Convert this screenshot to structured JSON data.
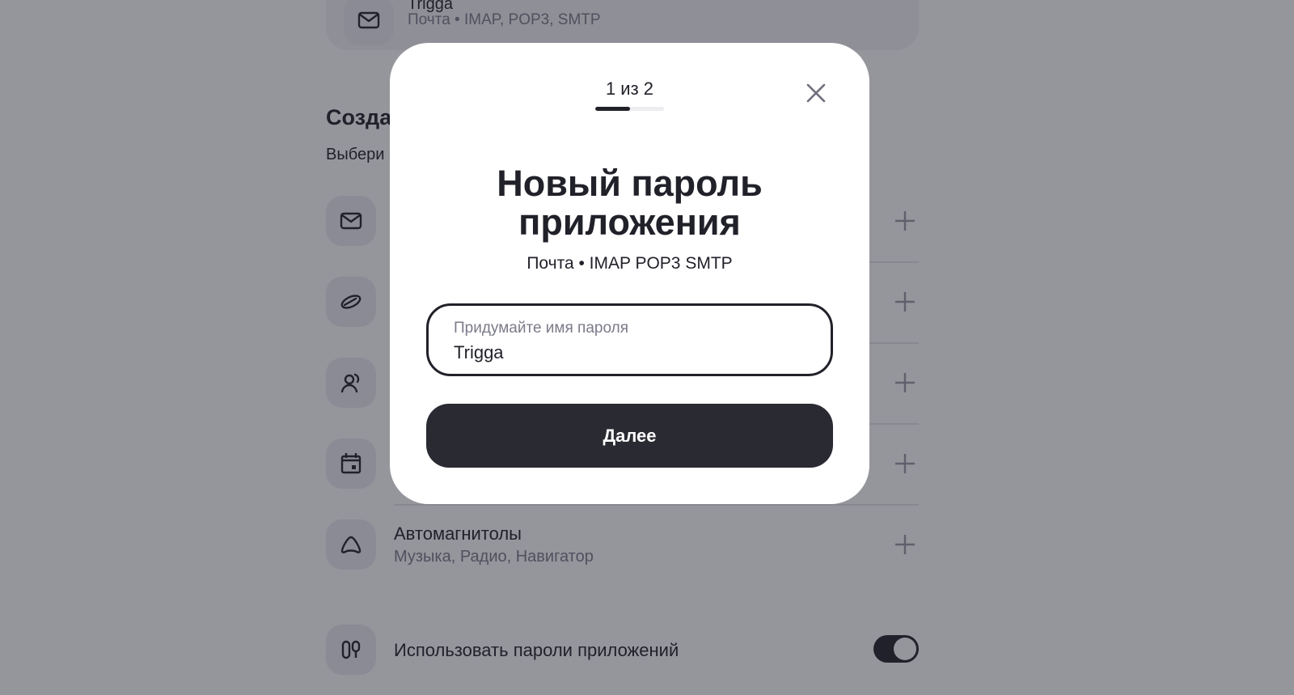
{
  "background": {
    "top_card": {
      "name": "Trigga",
      "subtitle": "Почта • IMAP, POP3, SMTP",
      "icon": "mail-icon"
    },
    "section": {
      "title": "Созда",
      "subtitle": "Выбери"
    },
    "rows": [
      {
        "icon": "mail-icon"
      },
      {
        "icon": "disk-icon"
      },
      {
        "icon": "contacts-icon"
      },
      {
        "icon": "calendar-icon"
      },
      {
        "icon": "car-icon",
        "title": "Автомагнитолы",
        "subtitle": "Музыка, Радио, Навигатор"
      }
    ],
    "app_passwords": {
      "icon": "keys-icon",
      "label": "Использовать пароли приложений",
      "enabled": true
    }
  },
  "modal": {
    "step_label": "1 из 2",
    "progress": 0.5,
    "title": "Новый пароль приложения",
    "subtitle": "Почта • IMAP POP3 SMTP",
    "field": {
      "label": "Придумайте имя пароля",
      "value": "Trigga"
    },
    "next_label": "Далее",
    "close_icon": "close-icon"
  },
  "colors": {
    "dark": "#21212a",
    "muted": "#7b7b8a",
    "overlay": "rgba(33,33,48,0.48)"
  }
}
